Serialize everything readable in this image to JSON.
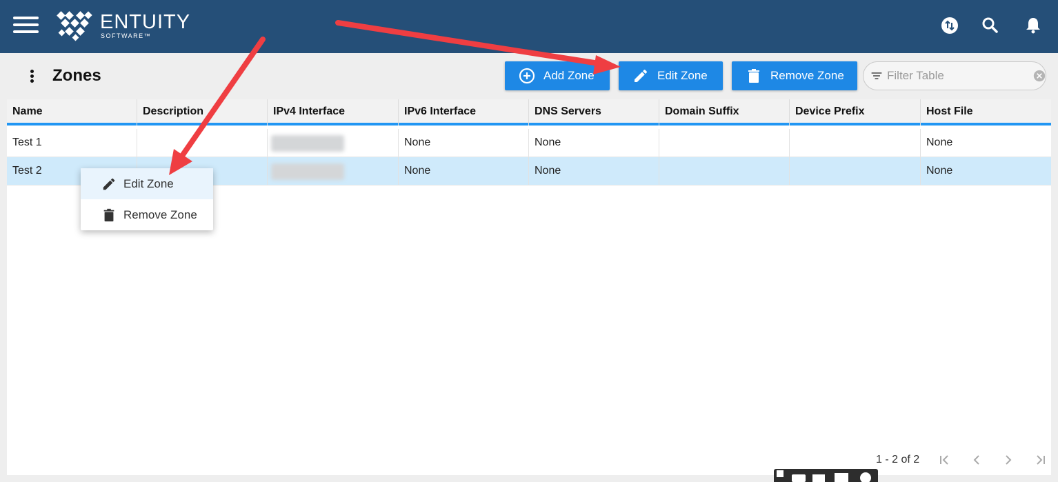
{
  "app": {
    "brand_name": "ENTUITY",
    "brand_sub": "SOFTWARE™"
  },
  "topbar": {
    "icons": [
      "menu-icon",
      "sync-icon",
      "search-icon",
      "bell-icon"
    ]
  },
  "page": {
    "title": "Zones"
  },
  "toolbar": {
    "add_label": "Add Zone",
    "edit_label": "Edit Zone",
    "remove_label": "Remove Zone",
    "filter_placeholder": "Filter Table"
  },
  "table": {
    "columns": [
      "Name",
      "Description",
      "IPv4 Interface",
      "IPv6 Interface",
      "DNS Servers",
      "Domain Suffix",
      "Device Prefix",
      "Host File"
    ],
    "rows": [
      {
        "name": "Test 1",
        "description": "",
        "ipv4": "",
        "ipv6": "None",
        "dns": "None",
        "domain": "",
        "prefix": "",
        "hostfile": "None",
        "selected": false
      },
      {
        "name": "Test 2",
        "description": "",
        "ipv4": "",
        "ipv6": "None",
        "dns": "None",
        "domain": "",
        "prefix": "",
        "hostfile": "None",
        "selected": true
      }
    ]
  },
  "context_menu": {
    "edit_label": "Edit Zone",
    "remove_label": "Remove Zone"
  },
  "pagination": {
    "range_text": "1 - 2 of 2"
  },
  "colors": {
    "topbar": "#254f78",
    "button": "#1e88e5",
    "header_underline": "#2196f3",
    "selected_row": "#cfeafb",
    "annotation_arrow": "#ef3e42"
  }
}
